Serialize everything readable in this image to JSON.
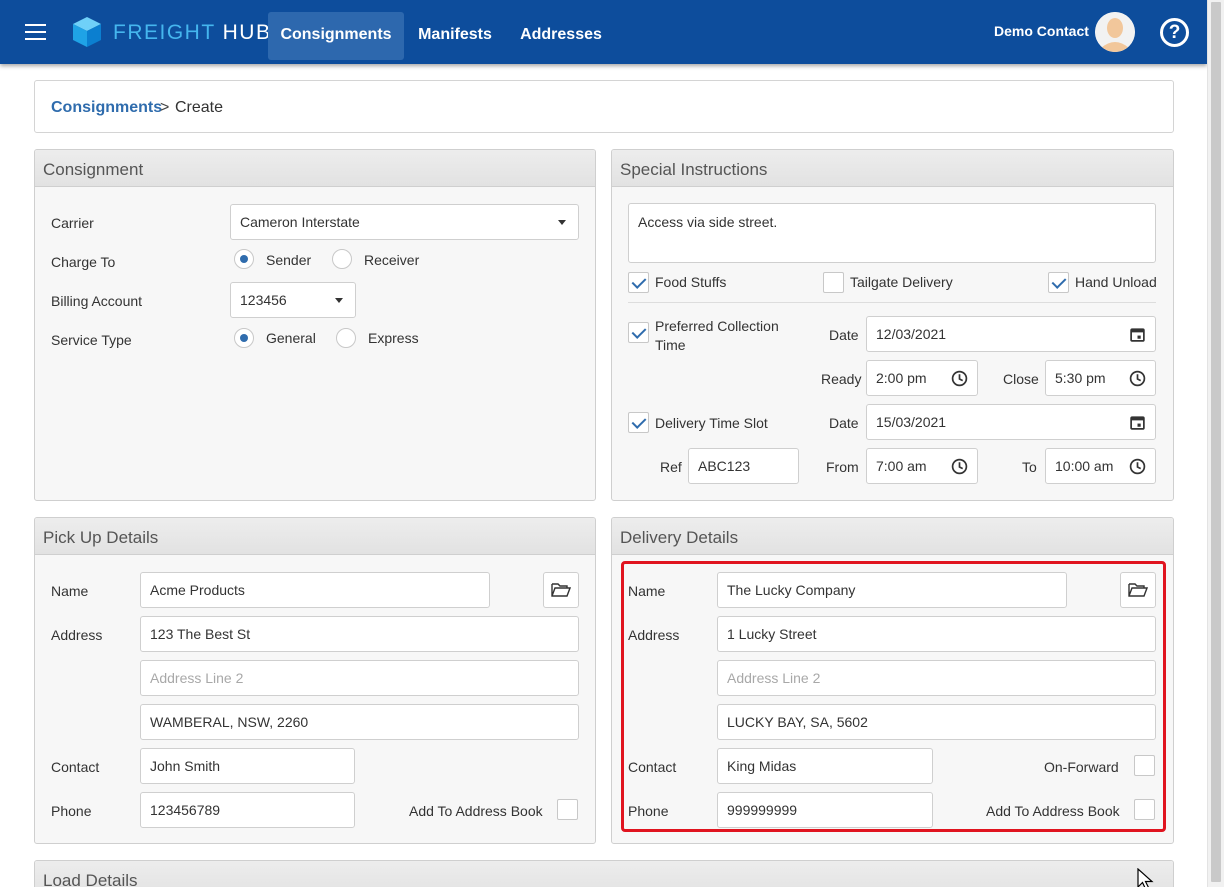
{
  "nav": {
    "brand_part1": "FREIGHT",
    "brand_part2": "HUB",
    "tabs": [
      {
        "label": "Consignments",
        "active": true
      },
      {
        "label": "Manifests",
        "active": false
      },
      {
        "label": "Addresses",
        "active": false
      }
    ],
    "user_name": "Demo Contact",
    "help_label": "?"
  },
  "breadcrumb": {
    "link": "Consignments",
    "separator": ">",
    "current": "Create"
  },
  "consignment": {
    "title": "Consignment",
    "carrier_label": "Carrier",
    "carrier_value": "Cameron Interstate",
    "charge_to_label": "Charge To",
    "charge_to_options": [
      "Sender",
      "Receiver"
    ],
    "charge_to_selected": "Sender",
    "billing_label": "Billing Account",
    "billing_value": "123456",
    "service_label": "Service Type",
    "service_options": [
      "General",
      "Express"
    ],
    "service_selected": "General"
  },
  "special": {
    "title": "Special Instructions",
    "instructions": "Access via side street.",
    "food_stuffs": "Food Stuffs",
    "tailgate": "Tailgate Delivery",
    "hand_unload": "Hand Unload",
    "pref_collection": "Preferred Collection Time",
    "date_label": "Date",
    "collection_date": "12/03/2021",
    "ready_label": "Ready",
    "ready_value": "2:00 pm",
    "close_label": "Close",
    "close_value": "5:30 pm",
    "delivery_slot": "Delivery Time Slot",
    "delivery_date": "15/03/2021",
    "ref_label": "Ref",
    "ref_value": "ABC123",
    "from_label": "From",
    "from_value": "7:00 am",
    "to_label": "To",
    "to_value": "10:00 am"
  },
  "pickup": {
    "title": "Pick Up Details",
    "name_label": "Name",
    "name_value": "Acme Products",
    "address_label": "Address",
    "address1": "123 The Best St",
    "address2_placeholder": "Address Line 2",
    "address3": "WAMBERAL, NSW, 2260",
    "contact_label": "Contact",
    "contact_value": "John Smith",
    "phone_label": "Phone",
    "phone_value": "123456789",
    "add_book_label": "Add To Address Book"
  },
  "delivery": {
    "title": "Delivery Details",
    "name_label": "Name",
    "name_value": "The Lucky Company",
    "address_label": "Address",
    "address1": "1 Lucky Street",
    "address2_placeholder": "Address Line 2",
    "address3": "LUCKY BAY, SA, 5602",
    "contact_label": "Contact",
    "contact_value": "King Midas",
    "on_forward_label": "On-Forward",
    "phone_label": "Phone",
    "phone_value": "999999999",
    "add_book_label": "Add To Address Book"
  },
  "load": {
    "title": "Load Details"
  },
  "colors": {
    "nav_bg": "#0d4d9c",
    "nav_active": "#2d68ae",
    "link": "#2f6cad",
    "highlight": "#e0141f"
  }
}
